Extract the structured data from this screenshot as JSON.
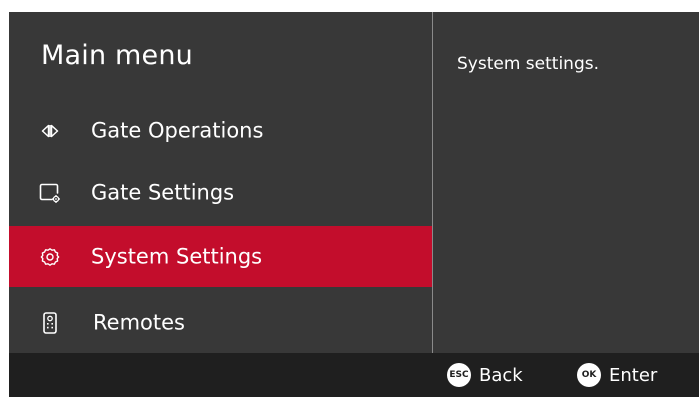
{
  "menu": {
    "title": "Main menu",
    "items": [
      {
        "label": "Gate Operations",
        "icon": "gate-operations-icon",
        "selected": false
      },
      {
        "label": "Gate Settings",
        "icon": "gate-settings-icon",
        "selected": false
      },
      {
        "label": "System Settings",
        "icon": "gear-icon",
        "selected": true
      },
      {
        "label": "Remotes",
        "icon": "remote-icon",
        "selected": false
      }
    ]
  },
  "detail": {
    "description": "System settings."
  },
  "footer": {
    "back_key": "ESC",
    "back_label": "Back",
    "enter_key": "OK",
    "enter_label": "Enter"
  },
  "colors": {
    "background": "#383838",
    "selected": "#c30d2c",
    "footer": "#1f1f1f",
    "divider": "#8a8a8a",
    "text": "#ffffff"
  }
}
